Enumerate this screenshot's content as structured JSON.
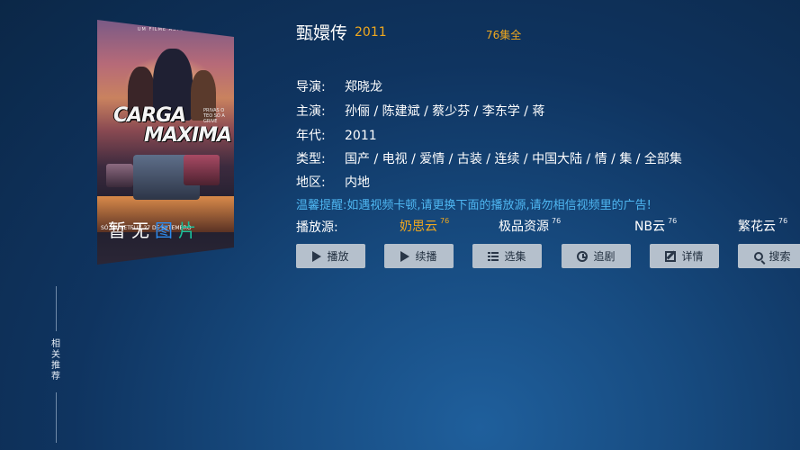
{
  "poster": {
    "studio": "UM FILME ASTELIA",
    "title_line1": "CARGA",
    "title_line2": "MAXIMA",
    "tagline": "PRIVAS O TEO SÓ A GRIVE",
    "release": "SÓ NA NETFLIX  27 DE SETEMBRO",
    "no_image_text": [
      "暂",
      "无",
      "图",
      "片"
    ]
  },
  "side": {
    "related_label": "相关推荐"
  },
  "header": {
    "title": "甄嬛传",
    "year": "2011",
    "episodes": "76集全"
  },
  "info": {
    "director_label": "导演:",
    "director": "郑晓龙",
    "cast_label": "主演:",
    "cast": "孙俪 / 陈建斌 / 蔡少芬 / 李东学 / 蒋",
    "era_label": "年代:",
    "era": "2011",
    "genre_label": "类型:",
    "genre": "国产 / 电视 / 爱情 / 古装 / 连续 / 中国大陆 / 情 / 集 / 全部集",
    "region_label": "地区:",
    "region": "内地"
  },
  "tip": "温馨提醒:如遇视频卡顿,请更换下面的播放源,请勿相信视频里的广告!",
  "sources": {
    "label": "播放源:",
    "items": [
      {
        "name": "奶思云",
        "count": "76"
      },
      {
        "name": "极品资源",
        "count": "76"
      },
      {
        "name": "NB云",
        "count": "76"
      },
      {
        "name": "繁花云",
        "count": "76"
      }
    ]
  },
  "actions": {
    "play": "播放",
    "resume": "续播",
    "episodes": "选集",
    "follow": "追剧",
    "details": "详情",
    "search": "搜索"
  },
  "colors": {
    "accent": "#f0a81e",
    "tip": "#4fb7f2",
    "button_bg": "#b5c0cc",
    "background": "#0f3460"
  }
}
